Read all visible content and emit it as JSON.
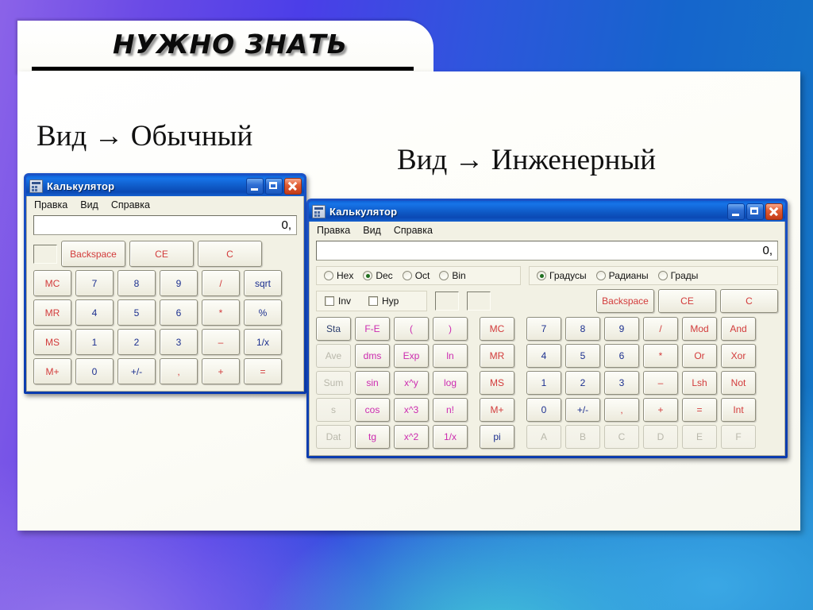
{
  "slide": {
    "heading": "НУЖНО ЗНАТЬ",
    "caption_basic": "Вид → Обычный",
    "caption_scientific": "Вид → Инженерный"
  },
  "colors": {
    "digit": "#1b2f8f",
    "operator": "#d23b3b",
    "memory": "#d23b3b",
    "function": "#cc2bb0",
    "disabled": "#b9b8ab",
    "titlebar": "#0f62d6",
    "panel": "#f2f1e4"
  },
  "window_basic": {
    "title": "Калькулятор",
    "icon": "calculator-icon",
    "buttons": {
      "minimize": "minimize-icon",
      "maximize": "maximize-icon",
      "close": "close-icon"
    },
    "menu": [
      "Правка",
      "Вид",
      "Справка"
    ],
    "display_value": "0,",
    "memory_indicator": "",
    "rows": [
      [
        {
          "label": "",
          "type": "indicator"
        },
        {
          "label": "Backspace",
          "type": "op",
          "wide": true
        },
        {
          "label": "CE",
          "type": "op",
          "wide": true
        },
        {
          "label": "C",
          "type": "op",
          "wide": true
        }
      ],
      [
        {
          "label": "MC",
          "type": "mem"
        },
        {
          "label": "7",
          "type": "digit"
        },
        {
          "label": "8",
          "type": "digit"
        },
        {
          "label": "9",
          "type": "digit"
        },
        {
          "label": "/",
          "type": "op"
        },
        {
          "label": "sqrt",
          "type": "digit"
        }
      ],
      [
        {
          "label": "MR",
          "type": "mem"
        },
        {
          "label": "4",
          "type": "digit"
        },
        {
          "label": "5",
          "type": "digit"
        },
        {
          "label": "6",
          "type": "digit"
        },
        {
          "label": "*",
          "type": "op"
        },
        {
          "label": "%",
          "type": "digit"
        }
      ],
      [
        {
          "label": "MS",
          "type": "mem"
        },
        {
          "label": "1",
          "type": "digit"
        },
        {
          "label": "2",
          "type": "digit"
        },
        {
          "label": "3",
          "type": "digit"
        },
        {
          "label": "–",
          "type": "op"
        },
        {
          "label": "1/x",
          "type": "digit"
        }
      ],
      [
        {
          "label": "M+",
          "type": "mem"
        },
        {
          "label": "0",
          "type": "digit"
        },
        {
          "label": "+/-",
          "type": "digit"
        },
        {
          "label": ",",
          "type": "op"
        },
        {
          "label": "+",
          "type": "op"
        },
        {
          "label": "=",
          "type": "op"
        }
      ]
    ]
  },
  "window_scientific": {
    "title": "Калькулятор",
    "icon": "calculator-icon",
    "buttons": {
      "minimize": "minimize-icon",
      "maximize": "maximize-icon",
      "close": "close-icon"
    },
    "menu": [
      "Правка",
      "Вид",
      "Справка"
    ],
    "display_value": "0,",
    "number_system": [
      {
        "label": "Hex",
        "selected": false
      },
      {
        "label": "Dec",
        "selected": true
      },
      {
        "label": "Oct",
        "selected": false
      },
      {
        "label": "Bin",
        "selected": false
      }
    ],
    "angle_units": [
      {
        "label": "Градусы",
        "selected": true
      },
      {
        "label": "Радианы",
        "selected": false
      },
      {
        "label": "Грады",
        "selected": false
      }
    ],
    "modifiers": [
      {
        "label": "Inv",
        "checked": false
      },
      {
        "label": "Hyp",
        "checked": false
      }
    ],
    "top_keys": [
      {
        "label": "Backspace",
        "type": "op"
      },
      {
        "label": "CE",
        "type": "op"
      },
      {
        "label": "C",
        "type": "op"
      }
    ],
    "rows": [
      [
        {
          "label": "Sta",
          "type": "stat"
        },
        {
          "label": "F-E",
          "type": "fn"
        },
        {
          "label": "(",
          "type": "fn"
        },
        {
          "label": ")",
          "type": "fn"
        },
        {
          "label": "MC",
          "type": "mem"
        },
        {
          "label": "7",
          "type": "digit"
        },
        {
          "label": "8",
          "type": "digit"
        },
        {
          "label": "9",
          "type": "digit"
        },
        {
          "label": "/",
          "type": "op"
        },
        {
          "label": "Mod",
          "type": "op"
        },
        {
          "label": "And",
          "type": "op"
        }
      ],
      [
        {
          "label": "Ave",
          "type": "disabled"
        },
        {
          "label": "dms",
          "type": "fn"
        },
        {
          "label": "Exp",
          "type": "fn"
        },
        {
          "label": "ln",
          "type": "fn"
        },
        {
          "label": "MR",
          "type": "mem"
        },
        {
          "label": "4",
          "type": "digit"
        },
        {
          "label": "5",
          "type": "digit"
        },
        {
          "label": "6",
          "type": "digit"
        },
        {
          "label": "*",
          "type": "op"
        },
        {
          "label": "Or",
          "type": "op"
        },
        {
          "label": "Xor",
          "type": "op"
        }
      ],
      [
        {
          "label": "Sum",
          "type": "disabled"
        },
        {
          "label": "sin",
          "type": "fn"
        },
        {
          "label": "x^y",
          "type": "fn"
        },
        {
          "label": "log",
          "type": "fn"
        },
        {
          "label": "MS",
          "type": "mem"
        },
        {
          "label": "1",
          "type": "digit"
        },
        {
          "label": "2",
          "type": "digit"
        },
        {
          "label": "3",
          "type": "digit"
        },
        {
          "label": "–",
          "type": "op"
        },
        {
          "label": "Lsh",
          "type": "op"
        },
        {
          "label": "Not",
          "type": "op"
        }
      ],
      [
        {
          "label": "s",
          "type": "disabled"
        },
        {
          "label": "cos",
          "type": "fn"
        },
        {
          "label": "x^3",
          "type": "fn"
        },
        {
          "label": "n!",
          "type": "fn"
        },
        {
          "label": "M+",
          "type": "mem"
        },
        {
          "label": "0",
          "type": "digit"
        },
        {
          "label": "+/-",
          "type": "digit"
        },
        {
          "label": ",",
          "type": "op"
        },
        {
          "label": "+",
          "type": "op"
        },
        {
          "label": "=",
          "type": "op"
        },
        {
          "label": "Int",
          "type": "op"
        }
      ],
      [
        {
          "label": "Dat",
          "type": "disabled"
        },
        {
          "label": "tg",
          "type": "fn"
        },
        {
          "label": "x^2",
          "type": "fn"
        },
        {
          "label": "1/x",
          "type": "fn"
        },
        {
          "label": "pi",
          "type": "digit"
        },
        {
          "label": "A",
          "type": "disabled"
        },
        {
          "label": "B",
          "type": "disabled"
        },
        {
          "label": "C",
          "type": "disabled"
        },
        {
          "label": "D",
          "type": "disabled"
        },
        {
          "label": "E",
          "type": "disabled"
        },
        {
          "label": "F",
          "type": "disabled"
        }
      ]
    ]
  }
}
